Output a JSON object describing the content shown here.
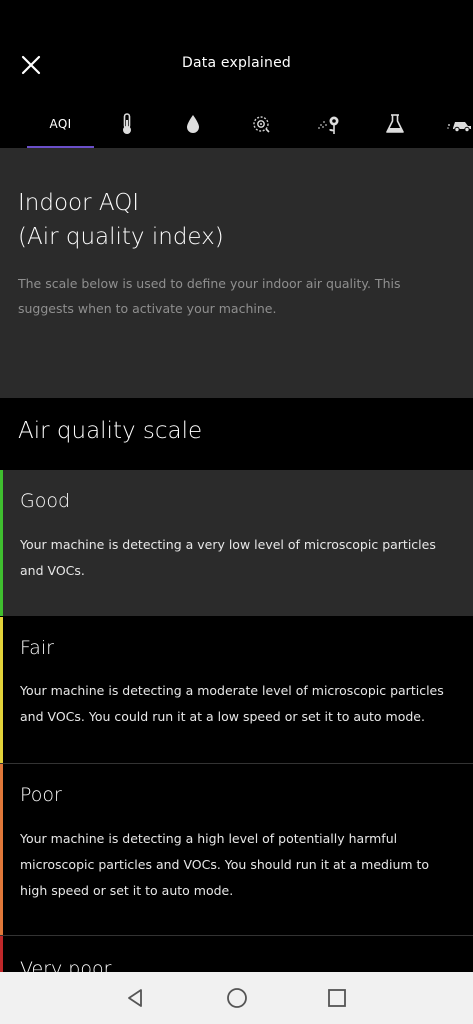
{
  "header": {
    "title": "Data explained"
  },
  "tabs": [
    {
      "label": "AQI",
      "icon": "aqi",
      "active": true
    },
    {
      "label": "",
      "icon": "thermometer-icon"
    },
    {
      "label": "",
      "icon": "humidity-drop-icon"
    },
    {
      "label": "",
      "icon": "particles-target-icon"
    },
    {
      "label": "",
      "icon": "pollen-flower-icon"
    },
    {
      "label": "",
      "icon": "chemistry-flask-icon"
    },
    {
      "label": "",
      "icon": "car-icon"
    }
  ],
  "intro": {
    "title_line1": "Indoor AQI",
    "title_line2": "(Air quality index)",
    "description": "The scale below is used to define your indoor air quality. This suggests when to activate your machine."
  },
  "scale": {
    "title": "Air quality scale",
    "levels": [
      {
        "name": "Good",
        "color": "#3fbf2f",
        "description": "Your machine is detecting a very low level of microscopic particles and VOCs."
      },
      {
        "name": "Fair",
        "color": "#e3d23a",
        "description": "Your machine is detecting a moderate level of microscopic particles and VOCs. You could run it at a low speed or set it to auto mode."
      },
      {
        "name": "Poor",
        "color": "#e0783a",
        "description": "Your machine is detecting a high level of potentially harmful microscopic particles and VOCs. You should run it at a medium to high speed or set it to auto mode."
      },
      {
        "name": "Very poor",
        "color": "#c0282a",
        "description": ""
      }
    ]
  },
  "colors": {
    "accent": "#6a4fc9",
    "card_background": "#2b2b2b"
  },
  "navbar": {
    "buttons": [
      "back-icon",
      "home-icon",
      "recents-icon"
    ]
  }
}
